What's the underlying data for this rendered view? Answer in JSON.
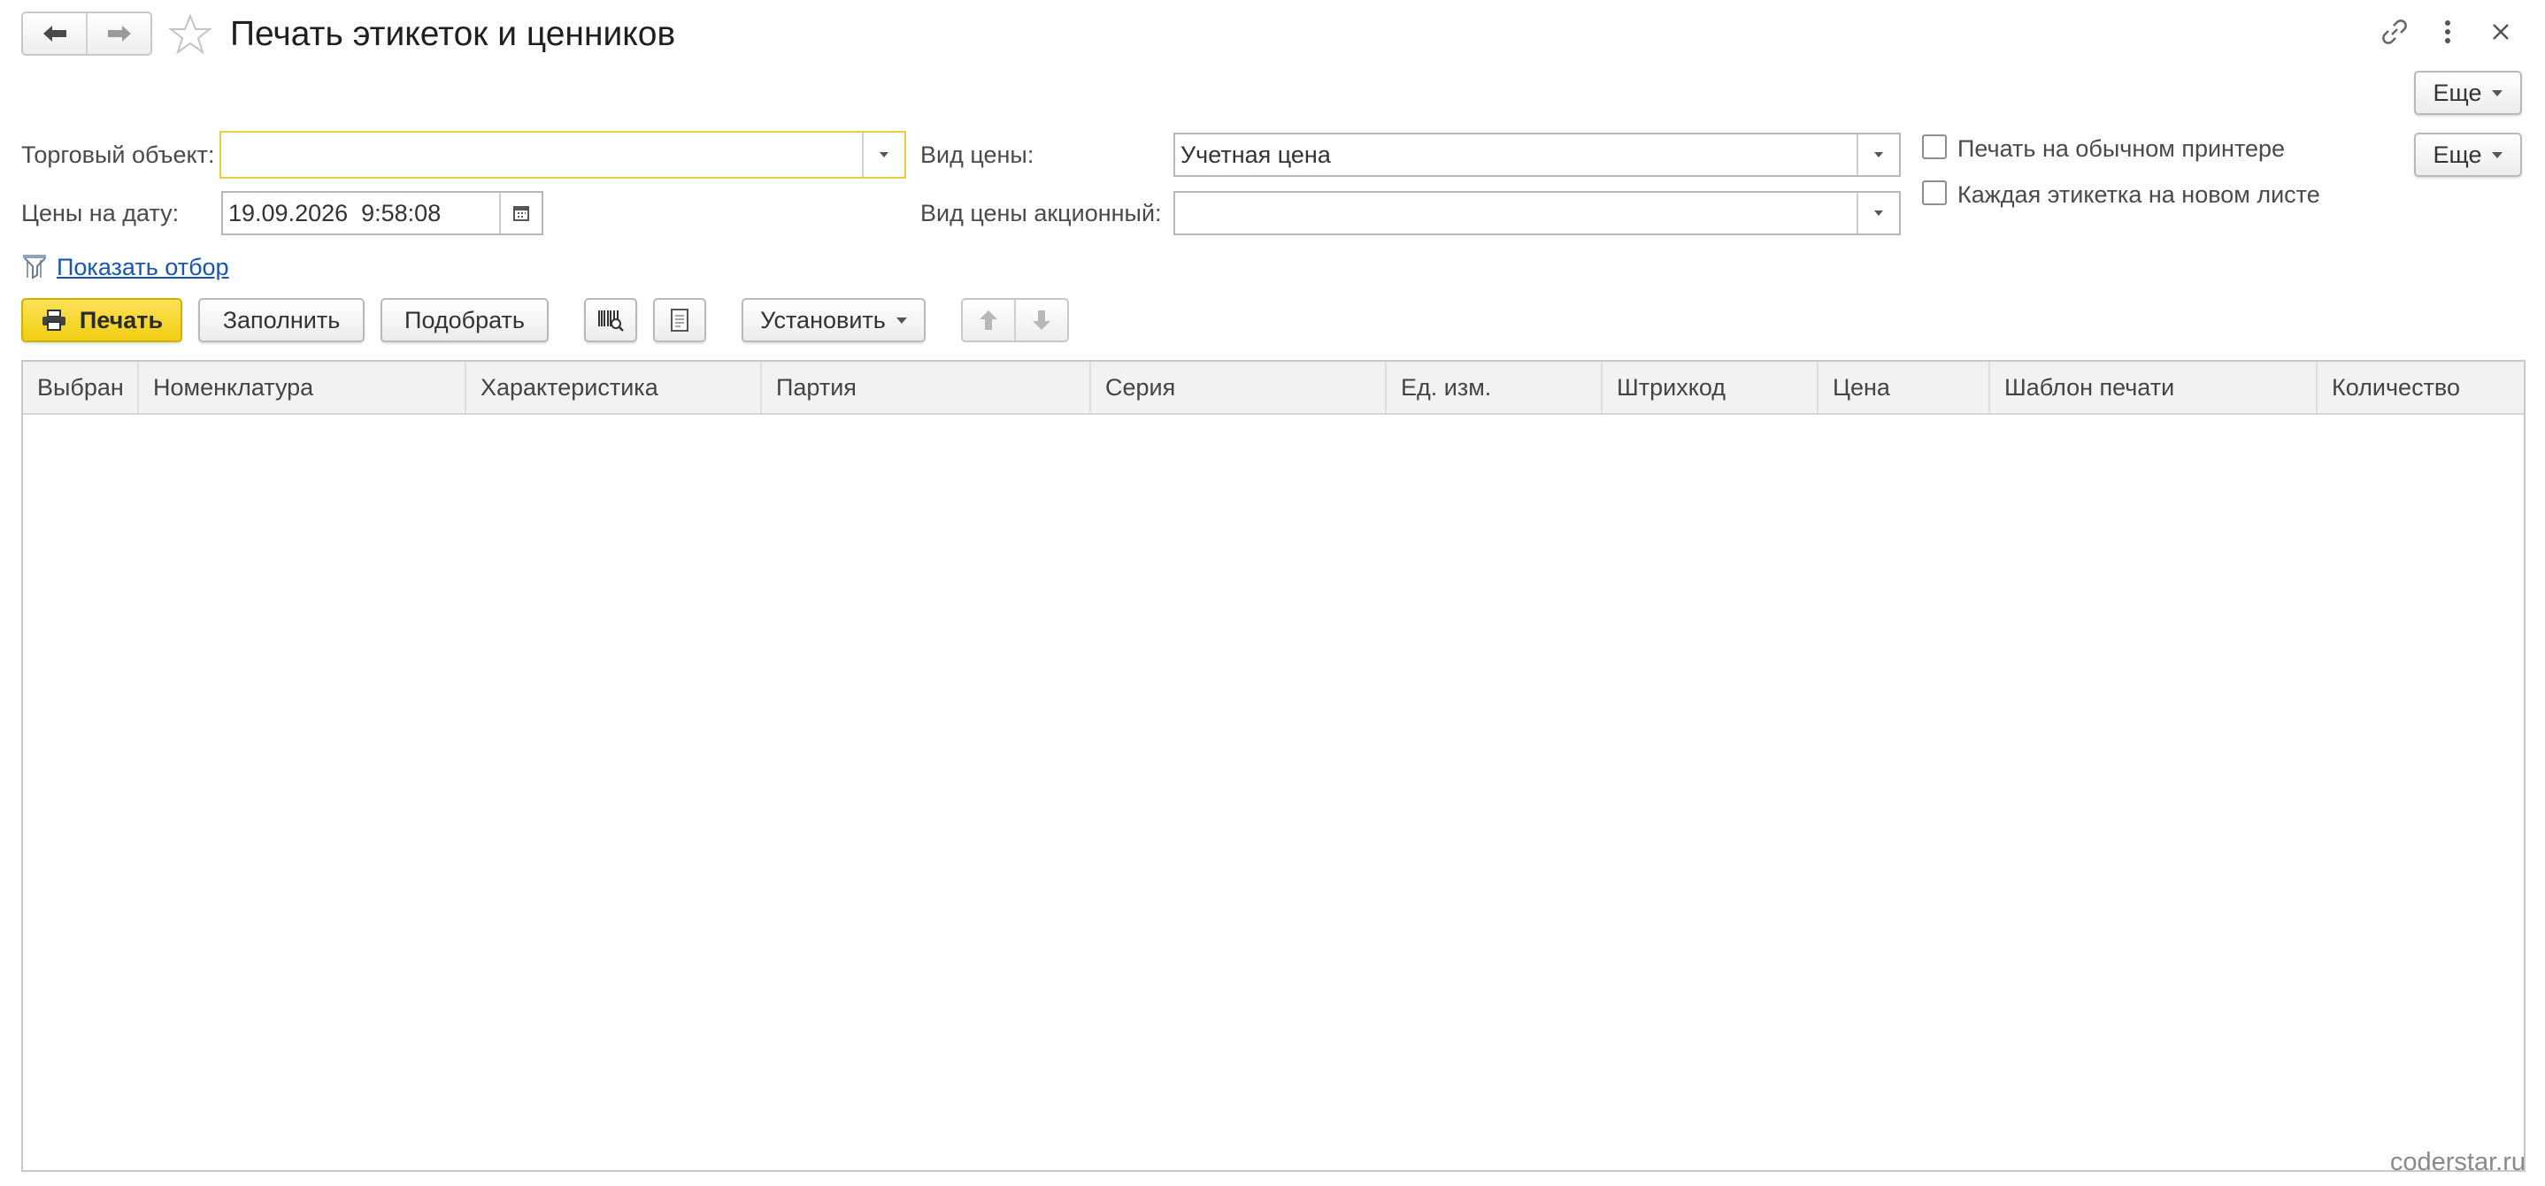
{
  "header": {
    "title": "Печать этикеток и ценников",
    "icons": [
      "arrow-left-icon",
      "arrow-right-icon",
      "star-icon",
      "link-icon",
      "more-vertical-icon",
      "close-icon"
    ]
  },
  "more_buttons": {
    "top": "Еще",
    "second": "Еще"
  },
  "form": {
    "trade_object": {
      "label": "Торговый объект:",
      "value": ""
    },
    "price_date": {
      "label": "Цены на дату:",
      "value": "19.09.2026  9:58:08"
    },
    "price_type": {
      "label": "Вид цены:",
      "value": "Учетная цена"
    },
    "promo_price_type": {
      "label": "Вид цены акционный:",
      "value": ""
    },
    "print_regular": {
      "label": "Печать на обычном принтере",
      "checked": false
    },
    "each_new_sheet": {
      "label": "Каждая этикетка на новом листе",
      "checked": false
    },
    "show_filter": "Показать отбор"
  },
  "toolbar": {
    "print": "Печать",
    "fill": "Заполнить",
    "pick": "Подобрать",
    "set": "Установить",
    "icons": [
      "barcode-search-icon",
      "document-icon",
      "move-up-icon",
      "move-down-icon",
      "printer-icon"
    ]
  },
  "table": {
    "columns": [
      "Выбран",
      "Номенклатура",
      "Характеристика",
      "Партия",
      "Серия",
      "Ед. изм.",
      "Штрихкод",
      "Цена",
      "Шаблон печати",
      "Количество"
    ],
    "rows": []
  },
  "watermark": "coderstar.ru",
  "colors": {
    "primary_button": "#f3d21c",
    "focus_border": "#e9cc40",
    "link": "#1a55b5"
  }
}
